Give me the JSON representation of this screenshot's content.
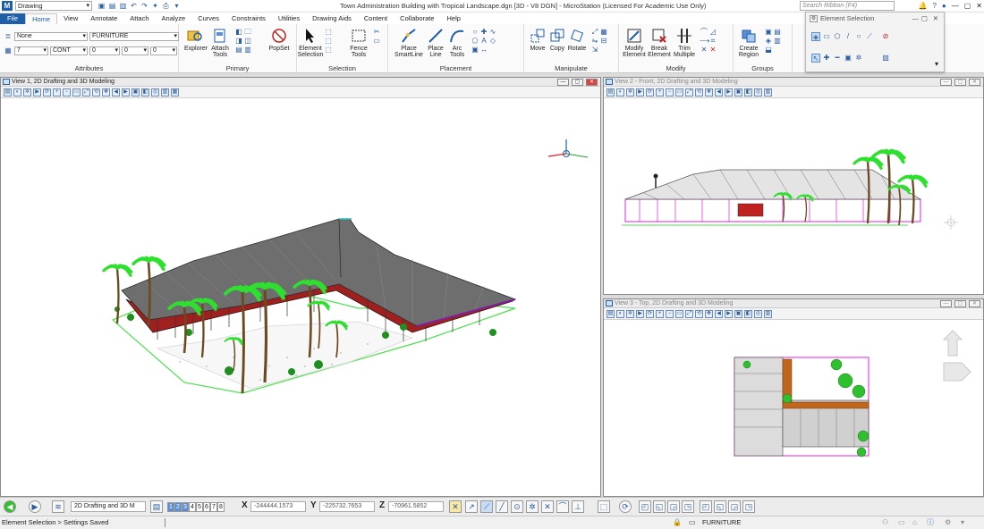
{
  "app": {
    "workspace": "Drawing",
    "window_title": "Town Administration Building with Tropical Landscape.dgn [3D - V8 DGN] - MicroStation (Licensed For Academic Use Only)",
    "search_placeholder": "Search Ribbon (F4)"
  },
  "tabs": [
    "File",
    "Home",
    "View",
    "Annotate",
    "Attach",
    "Analyze",
    "Curves",
    "Constraints",
    "Utilities",
    "Drawing Aids",
    "Content",
    "Collaborate",
    "Help"
  ],
  "ribbon": {
    "attributes": {
      "level": "None",
      "style_name": "FURNITURE",
      "color": "7",
      "linestyle": "CONT",
      "weight": "0",
      "transparency": "0",
      "priority": "0",
      "label": "Attributes"
    },
    "primary": {
      "explorer": "Explorer",
      "attach_tools": "Attach Tools",
      "popset": "PopSet",
      "label": "Primary"
    },
    "selection": {
      "element_selection": "Element Selection",
      "fence_tools": "Fence Tools",
      "label": "Selection"
    },
    "placement": {
      "place_smartline": "Place SmartLine",
      "place_line": "Place Line",
      "arc_tools": "Arc Tools",
      "label": "Placement"
    },
    "manipulate": {
      "move": "Move",
      "copy": "Copy",
      "rotate": "Rotate",
      "label": "Manipulate"
    },
    "modify": {
      "modify_element": "Modify Element",
      "break_element": "Break Element",
      "trim_multiple": "Trim Multiple",
      "label": "Modify"
    },
    "groups": {
      "create_region": "Create Region",
      "label": "Groups"
    }
  },
  "element_selection_panel": {
    "title": "Element Selection"
  },
  "views": {
    "v1": {
      "title": "View 1, 2D Drafting and 3D Modeling"
    },
    "v2": {
      "title": "View 2 - Front, 2D Drafting and 3D Modeling"
    },
    "v3": {
      "title": "View 3 - Top, 2D Drafting and 3D Modeling"
    }
  },
  "statusbar": {
    "view_group": "2D Drafting and 3D M",
    "view_numbers": [
      "1",
      "2",
      "3",
      "4",
      "5",
      "6",
      "7",
      "8"
    ],
    "x_label": "X",
    "x_value": "-244444.1573",
    "y_label": "Y",
    "y_value": "-225732.7653",
    "z_label": "Z",
    "z_value": "-70961.5852"
  },
  "message": {
    "text": "Element Selection > Settings Saved",
    "active_level": "FURNITURE"
  },
  "colors": {
    "accent": "#1f5fa8",
    "palm": "#2ee02e",
    "roof": "#6e6e6e",
    "magenta": "#e020e0"
  }
}
